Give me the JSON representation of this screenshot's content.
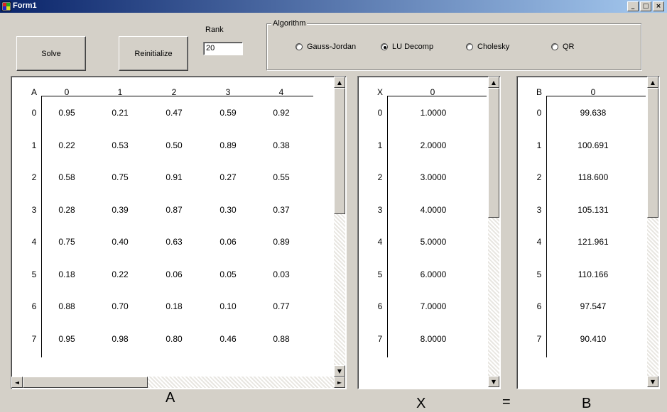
{
  "window": {
    "title": "Form1",
    "minimize": "_",
    "maximize": "□",
    "close": "×"
  },
  "buttons": {
    "solve": "Solve",
    "reinit": "Reinitialize"
  },
  "rank": {
    "label": "Rank",
    "value": "20"
  },
  "algorithm": {
    "legend": "Algorithm",
    "options": [
      {
        "label": "Gauss-Jordan",
        "selected": false
      },
      {
        "label": "LU Decomp",
        "selected": true
      },
      {
        "label": "Cholesky",
        "selected": false
      },
      {
        "label": "QR",
        "selected": false
      }
    ]
  },
  "matrixA": {
    "corner": "A",
    "cols": [
      "0",
      "1",
      "2",
      "3",
      "4"
    ],
    "rows": [
      "0",
      "1",
      "2",
      "3",
      "4",
      "5",
      "6",
      "7"
    ],
    "values": [
      [
        "0.95",
        "0.21",
        "0.47",
        "0.59",
        "0.92"
      ],
      [
        "0.22",
        "0.53",
        "0.50",
        "0.89",
        "0.38"
      ],
      [
        "0.58",
        "0.75",
        "0.91",
        "0.27",
        "0.55"
      ],
      [
        "0.28",
        "0.39",
        "0.87",
        "0.30",
        "0.37"
      ],
      [
        "0.75",
        "0.40",
        "0.63",
        "0.06",
        "0.89"
      ],
      [
        "0.18",
        "0.22",
        "0.06",
        "0.05",
        "0.03"
      ],
      [
        "0.88",
        "0.70",
        "0.18",
        "0.10",
        "0.77"
      ],
      [
        "0.95",
        "0.98",
        "0.80",
        "0.46",
        "0.88"
      ]
    ]
  },
  "vectorX": {
    "corner": "X",
    "col": "0",
    "rows": [
      "0",
      "1",
      "2",
      "3",
      "4",
      "5",
      "6",
      "7"
    ],
    "values": [
      "1.0000",
      "2.0000",
      "3.0000",
      "4.0000",
      "5.0000",
      "6.0000",
      "7.0000",
      "8.0000"
    ]
  },
  "vectorB": {
    "corner": "B",
    "col": "0",
    "rows": [
      "0",
      "1",
      "2",
      "3",
      "4",
      "5",
      "6",
      "7"
    ],
    "values": [
      "99.638",
      "100.691",
      "118.600",
      "105.131",
      "121.961",
      "110.166",
      "97.547",
      "90.410"
    ]
  },
  "captions": {
    "a": "A",
    "x": "X",
    "eq": "=",
    "b": "B"
  }
}
